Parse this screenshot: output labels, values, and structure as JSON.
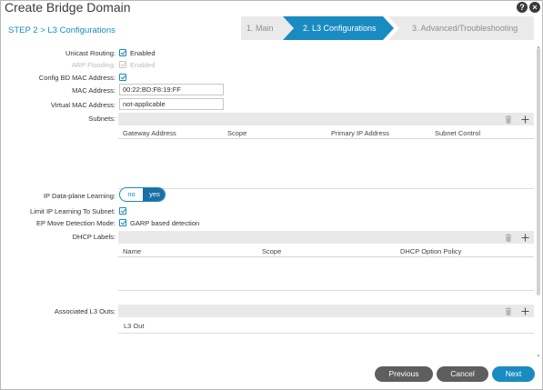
{
  "header": {
    "title": "Create Bridge Domain",
    "help_icon": "?",
    "close_icon": "×"
  },
  "step_label": "STEP 2 > L3 Configurations",
  "wizard": {
    "steps": [
      "1. Main",
      "2. L3 Configurations",
      "3. Advanced/Troubleshooting"
    ],
    "active_index": 1
  },
  "form": {
    "unicast_routing": {
      "label": "Unicast Routing:",
      "value": "Enabled",
      "checked": true
    },
    "arp_flooding": {
      "label": "ARP Flooding:",
      "value": "Enabled",
      "checked": true,
      "disabled": true
    },
    "config_bd_mac": {
      "label": "Config BD MAC Address:",
      "checked": true
    },
    "mac_address": {
      "label": "MAC Address:",
      "value": "00:22:BD:F8:19:FF"
    },
    "virtual_mac": {
      "label": "Virtual MAC Address:",
      "value": "not-applicable"
    },
    "subnets": {
      "label": "Subnets:",
      "columns": [
        "Gateway Address",
        "Scope",
        "Primary IP Address",
        "Subnet Control"
      ]
    },
    "ip_dataplane": {
      "label": "IP Data-plane Learning:",
      "options": [
        "no",
        "yes"
      ],
      "selected": "yes"
    },
    "limit_ip": {
      "label": "Limit IP Learning To Subnet:",
      "checked": true
    },
    "ep_move": {
      "label": "EP Move Detection Mode:",
      "value": "GARP based detection",
      "checked": true
    },
    "dhcp_labels": {
      "label": "DHCP Labels:",
      "columns": [
        "Name",
        "Scope",
        "DHCP Option Policy"
      ]
    },
    "l3_outs": {
      "label": "Associated L3 Outs:",
      "columns": [
        "L3 Out"
      ]
    }
  },
  "footer": {
    "previous": "Previous",
    "cancel": "Cancel",
    "next": "Next"
  },
  "colors": {
    "accent": "#1a8bc0",
    "button_dark": "#5e5e5e",
    "toolbar_gray": "#e9e9e9"
  },
  "icons": {
    "delete": "trash-icon",
    "add": "plus-icon"
  }
}
